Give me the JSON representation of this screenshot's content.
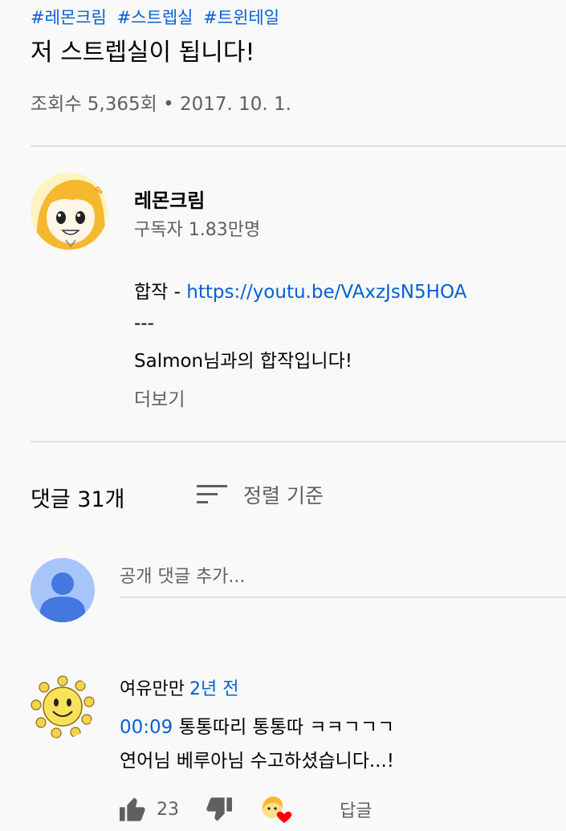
{
  "video": {
    "hashtags": [
      "#레몬크림",
      "#스트렙실",
      "#트윈테일"
    ],
    "title": "저 스트렙실이 됩니다!",
    "meta": "조회수 5,365회 • 2017. 10. 1."
  },
  "channel": {
    "name": "레몬크림",
    "subscribers": "구독자 1.83만명",
    "avatar_icon": "lemon-girl-avatar"
  },
  "description": {
    "collab_prefix": "합작 - ",
    "collab_link": "https://youtu.be/VAxzJsN5HOA",
    "separator": "---",
    "line": "Salmon님과의 합작입니다!",
    "more_label": "더보기"
  },
  "comments": {
    "count_label": "댓글 31개",
    "sort_label": "정렬 기준",
    "add_placeholder": "공개 댓글 추가...",
    "items": [
      {
        "author": "여유만만",
        "time": "2년 전",
        "timestamp_link": "00:09",
        "text_rest": " 통통따리 통통따 ㅋㅋㄱㄱㄱ",
        "text_line2": "연어님 베루아님 수고하셨습니다...!",
        "likes": "23",
        "reply_label": "답글"
      }
    ]
  },
  "colors": {
    "link": "#065fd4",
    "secondary_text": "#606060",
    "divider": "#e0e0e0",
    "heart": "#ff0000"
  }
}
